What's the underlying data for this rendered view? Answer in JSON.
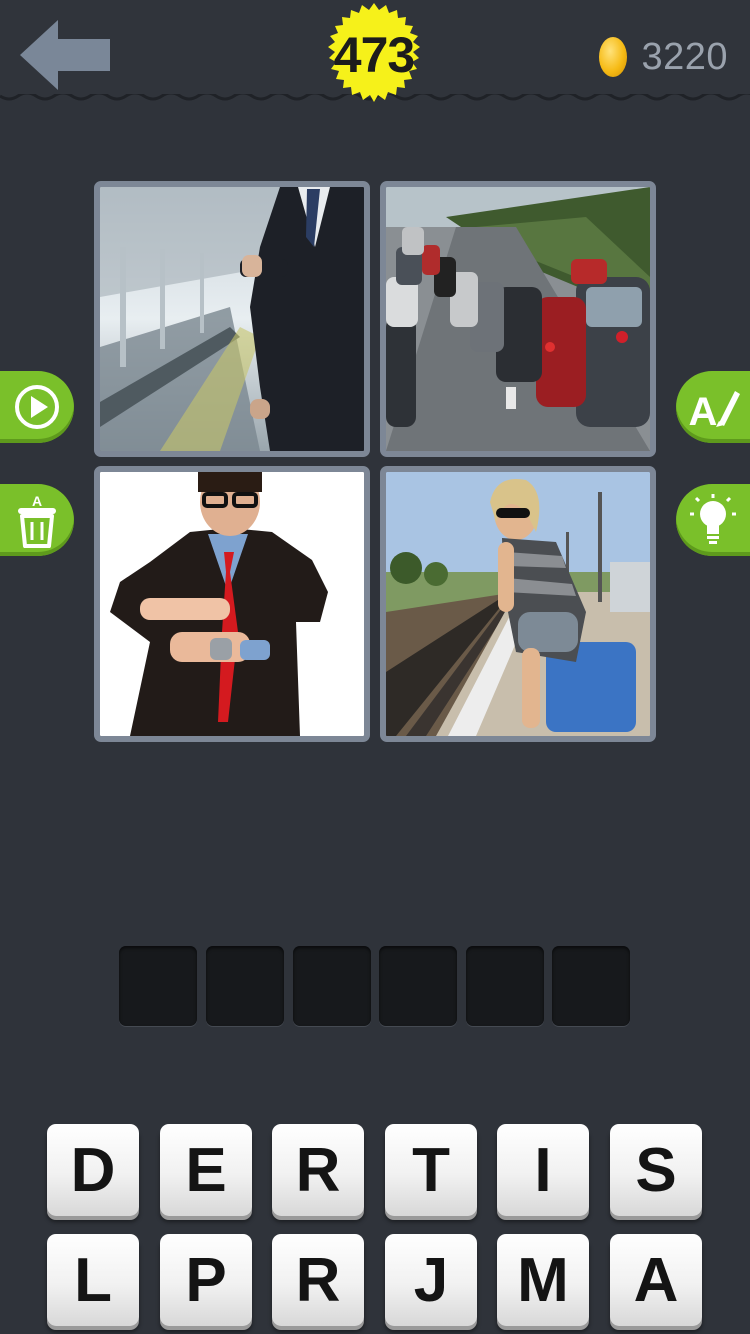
{
  "header": {
    "level": "473",
    "coins": "3220",
    "back_icon": "back-arrow-icon",
    "coin_icon": "coin-icon",
    "colors": {
      "badge": "#f6f11a",
      "coin": "#f6bb16",
      "accent_green": "#7ac02a"
    }
  },
  "photos": [
    {
      "name": "photo-businessman-train-platform"
    },
    {
      "name": "photo-traffic-jam"
    },
    {
      "name": "photo-man-pointing-at-watch"
    },
    {
      "name": "photo-woman-on-suitcase-railway"
    }
  ],
  "side_buttons": {
    "play": "play-icon",
    "remove_letters": "trash-icon",
    "reveal_letter": "reveal-letter-icon",
    "hint": "lightbulb-icon"
  },
  "answer_slots": [
    "",
    "",
    "",
    "",
    "",
    ""
  ],
  "letters": {
    "row1": [
      "D",
      "E",
      "R",
      "T",
      "I",
      "S"
    ],
    "row2": [
      "L",
      "P",
      "R",
      "J",
      "M",
      "A"
    ]
  }
}
